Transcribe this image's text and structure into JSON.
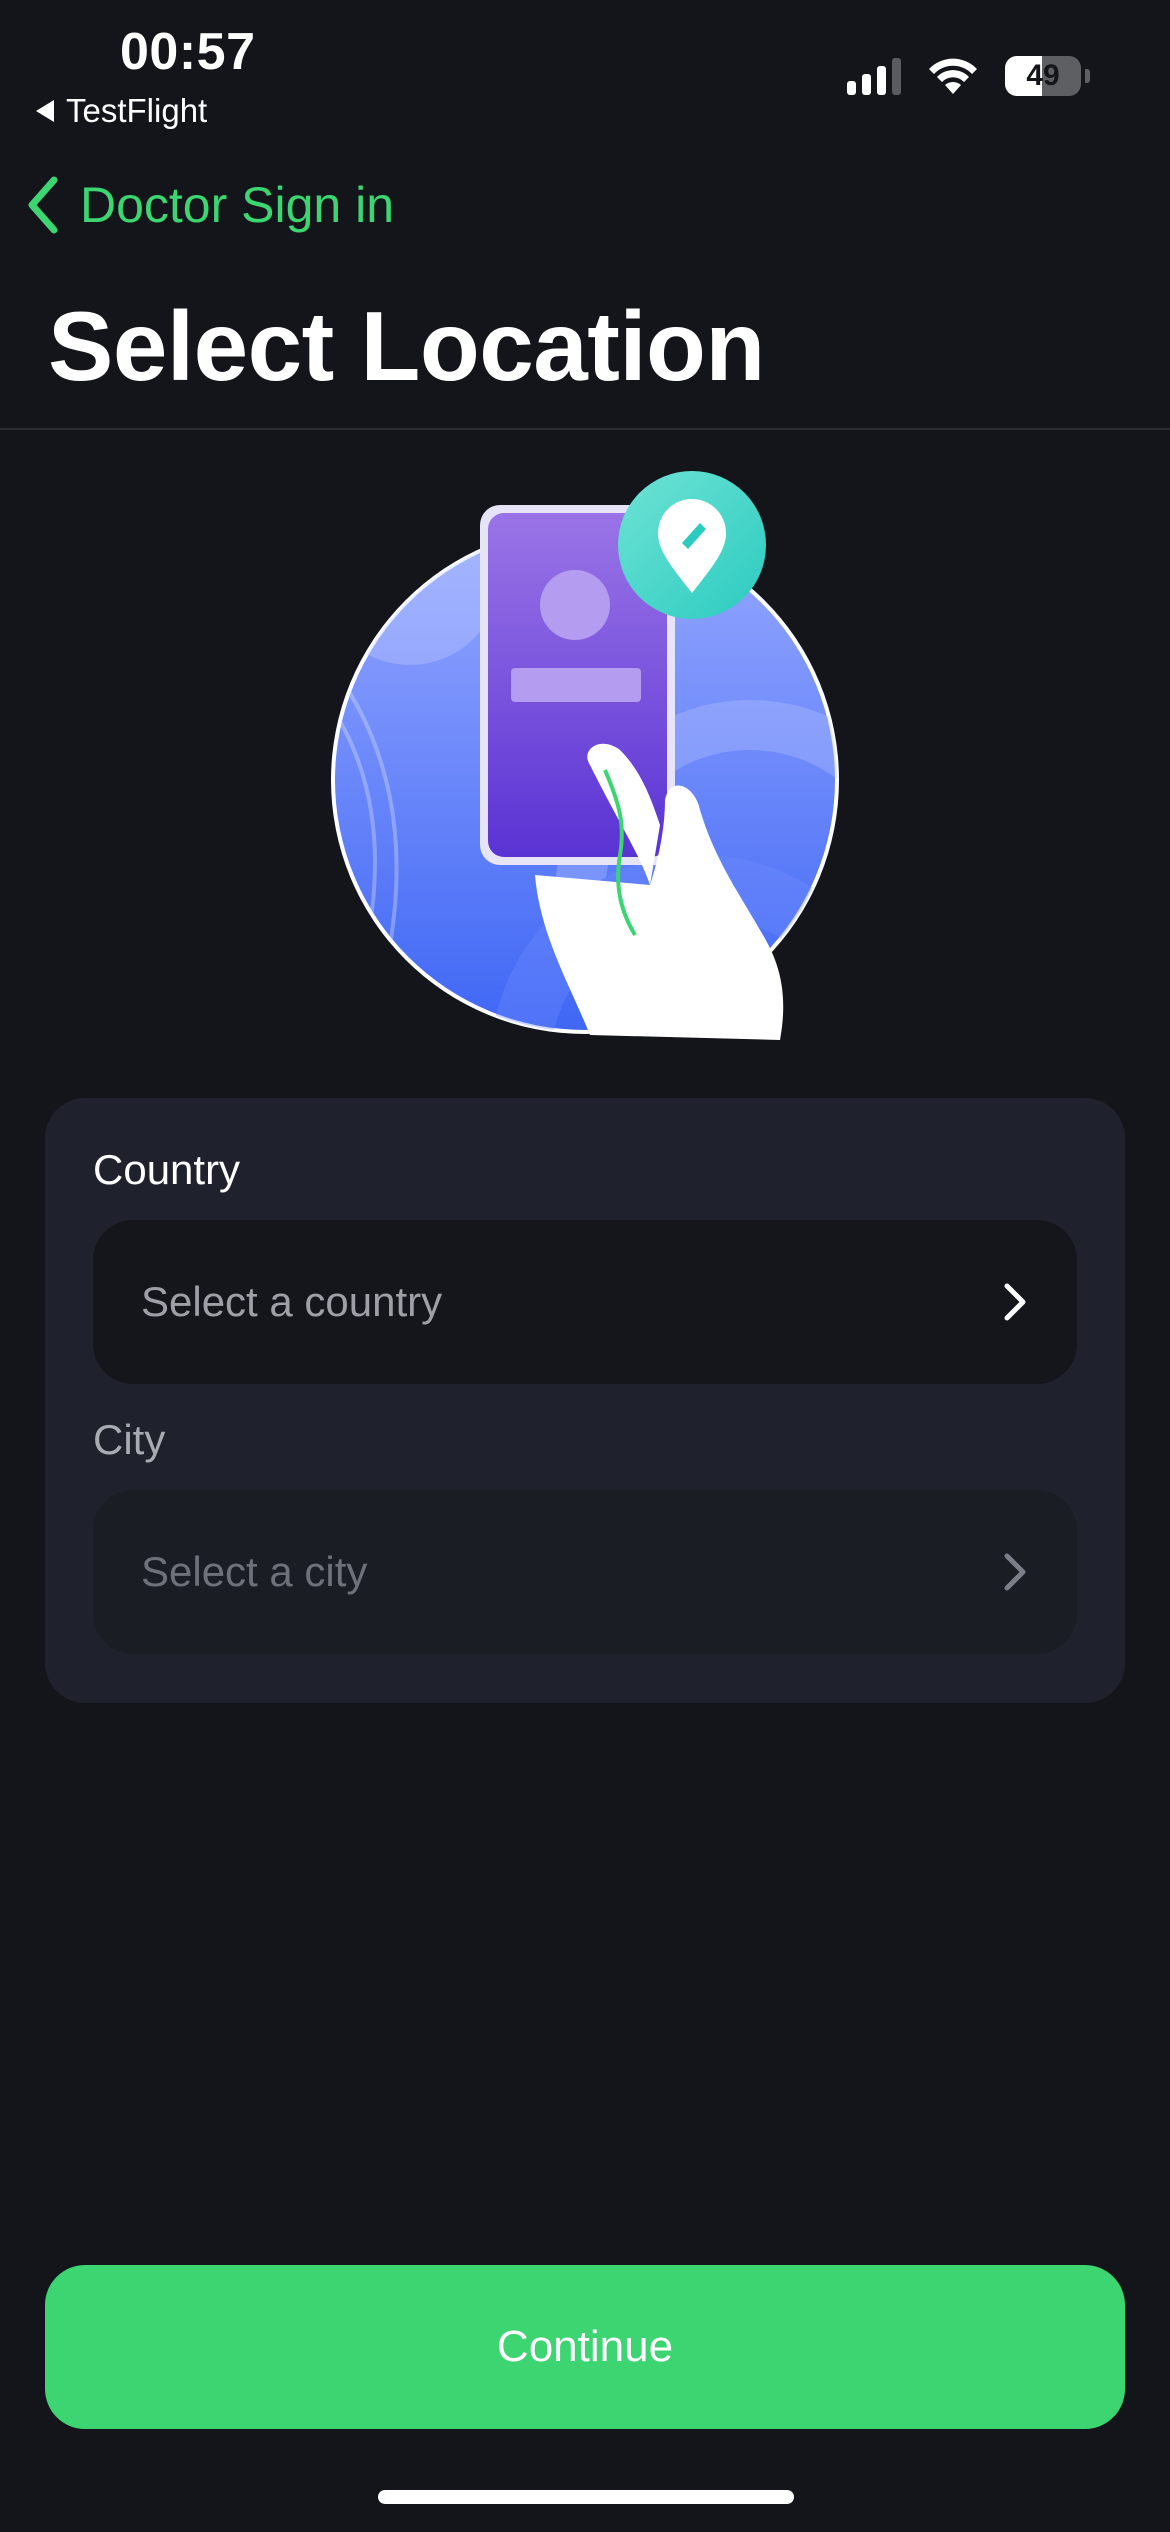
{
  "status_bar": {
    "time": "00:57",
    "back_app": "TestFlight",
    "battery_level": "49",
    "icons": [
      "cellular-signal-icon",
      "wifi-icon",
      "battery-icon"
    ]
  },
  "nav": {
    "back_label": "Doctor Sign in",
    "back_icon": "chevron-left-icon"
  },
  "page": {
    "title": "Select Location"
  },
  "illustration": {
    "icon": "location-pin-icon"
  },
  "form": {
    "country": {
      "label": "Country",
      "placeholder": "Select a country",
      "enabled": true
    },
    "city": {
      "label": "City",
      "placeholder": "Select a city",
      "enabled": false
    }
  },
  "actions": {
    "continue_label": "Continue"
  },
  "colors": {
    "background": "#14151a",
    "accent": "#3cd572",
    "card": "#1f222d",
    "input": "#15161b"
  }
}
